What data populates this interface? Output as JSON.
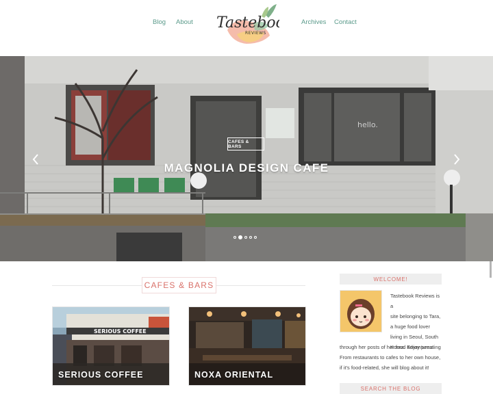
{
  "nav": {
    "blog": "Blog",
    "about": "About",
    "archives": "Archives",
    "contact": "Contact"
  },
  "logo": {
    "name": "Tastebook",
    "tagline": "REVIEWS"
  },
  "hero": {
    "category": "CAFES & BARS",
    "title": "MAGNOLIA DESIGN CAFE",
    "slide_count": 5,
    "active_slide": 2,
    "window_text": "hello."
  },
  "section": {
    "heading": "CAFES & BARS"
  },
  "posts": [
    {
      "title": "SERIOUS COFFEE"
    },
    {
      "title": "NOXA ORIENTAL"
    }
  ],
  "sidebar": {
    "welcome_heading": "WELCOME!",
    "welcome_lines": [
      "Tastebook Reviews is a",
      "site belonging to Tara,",
      "a huge food lover",
      "living in Seoul, South",
      "Korea. Enjoy perusing",
      "through her posts of her food adventures!",
      "From restaurants to cafes to her own house,",
      "if it's food-related, she will blog about it!"
    ],
    "search_heading": "SEARCH THE BLOG"
  },
  "colors": {
    "accent": "#d9716a",
    "nav": "#5a9a8a",
    "widget_bg": "#eeeeee"
  }
}
